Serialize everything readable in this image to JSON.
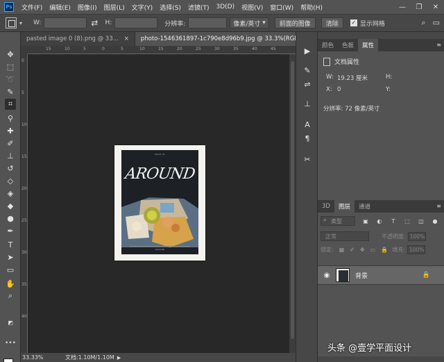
{
  "app": {
    "logo": "Ps"
  },
  "menu": [
    "文件(F)",
    "编辑(E)",
    "图像(I)",
    "图层(L)",
    "文字(Y)",
    "选择(S)",
    "滤镜(T)",
    "3D(D)",
    "视图(V)",
    "窗口(W)",
    "帮助(H)"
  ],
  "window_controls": {
    "minimize": "—",
    "restore": "❐",
    "close": "✕"
  },
  "options": {
    "w_label": "W:",
    "h_label": "H:",
    "resolution_label": "分辨率:",
    "unit_select": "像素/英寸",
    "front_image_button": "前面的图像",
    "clear_button": "清除",
    "delete_crop_checked": true,
    "delete_crop_label": "显示网格"
  },
  "tabs": [
    {
      "label": "pasted image 0 (8).png @ 33...",
      "close": "×"
    },
    {
      "label": "photo-1546361897-1c790e8d96b9.jpg @ 33.3%(RGB/8) *",
      "close": "×"
    }
  ],
  "ruler": {
    "top": [
      "15",
      "10",
      "5",
      "0",
      "5",
      "10",
      "15",
      "20",
      "25",
      "30",
      "35",
      "40",
      "45"
    ],
    "left": [
      "0",
      "5",
      "10",
      "15",
      "20",
      "25",
      "30",
      "35",
      "40"
    ]
  },
  "document": {
    "cover_title": "AROUND",
    "cover_top_text": "ISSUE 01",
    "cover_bottom_text": "AROUND"
  },
  "status": {
    "zoom": "33.33%",
    "doc_info": "文档:1.10M/1.10M",
    "arrow": "▶"
  },
  "panel_top": {
    "tabs": [
      "颜色",
      "色板",
      "属性"
    ],
    "active_tab": 2,
    "heading": "文档属性",
    "w_label": "W:",
    "w_value": "19.23 厘米",
    "h_label": "H:",
    "x_label": "X:",
    "x_value": "0",
    "y_label": "Y:",
    "resolution": "分辨率: 72 像素/英寸"
  },
  "panel_layers": {
    "tabs": [
      "3D",
      "图层",
      "通道"
    ],
    "active_tab": 1,
    "filter_placeholder": "类型",
    "blend_mode": "正常",
    "opacity_label": "不透明度:",
    "opacity_value": "100%",
    "lock_label": "锁定:",
    "fill_label": "填充:",
    "fill_value": "100%",
    "layer_name": "背景"
  },
  "watermark": "头条 @壹学平面设计"
}
